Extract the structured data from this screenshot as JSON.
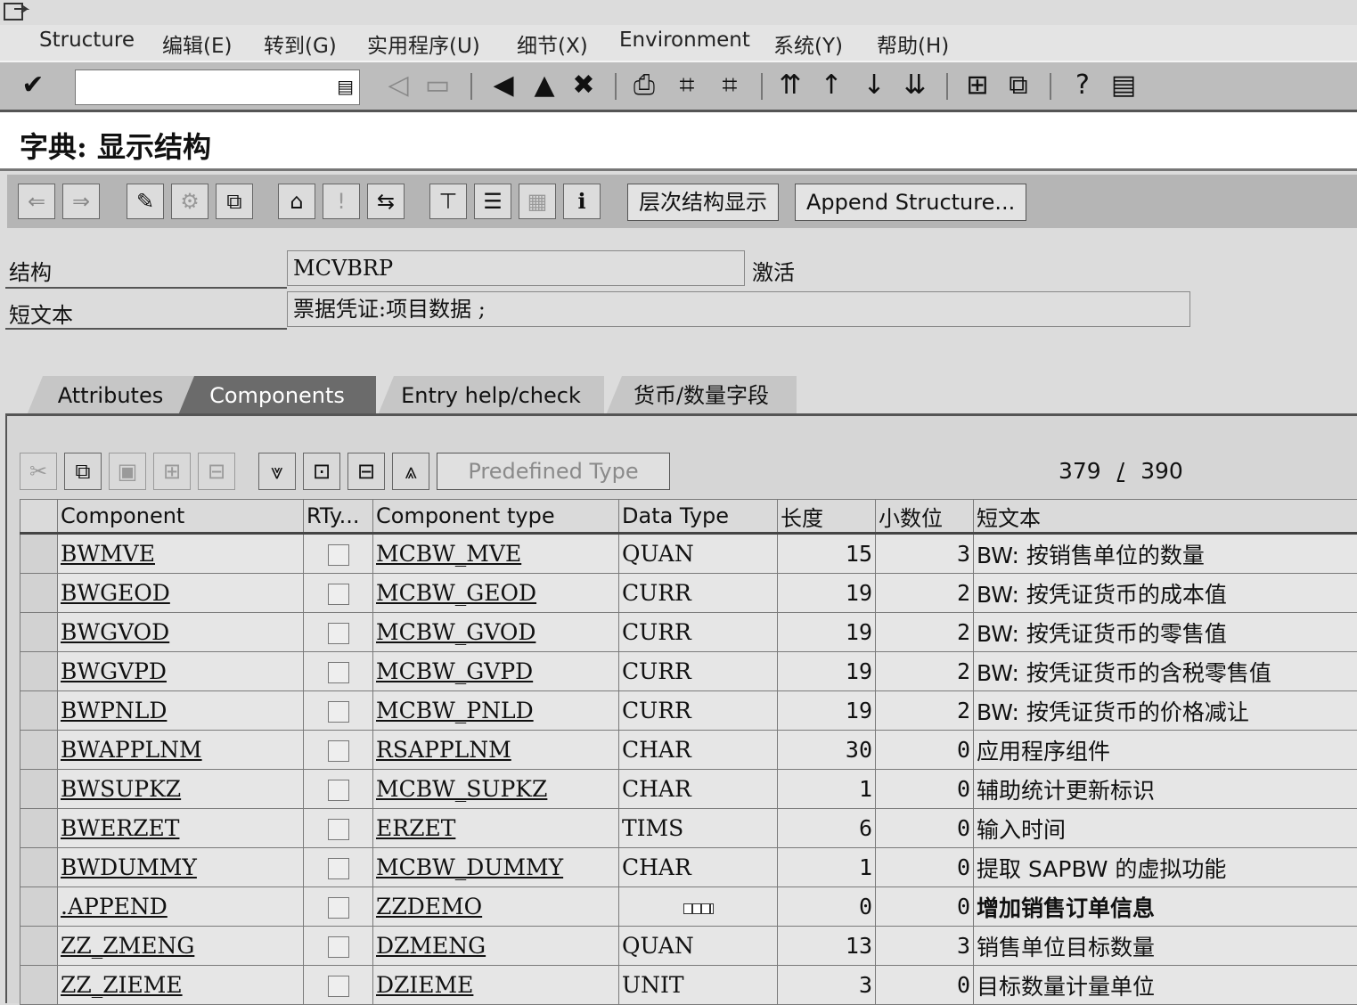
{
  "menu": [
    "Structure",
    "编辑(E)",
    "转到(G)",
    "实用程序(U)",
    "细节(X)",
    "Environment",
    "系统(Y)",
    "帮助(H)"
  ],
  "command_field": {
    "value": ""
  },
  "title": "字典: 显示结构",
  "app_toolbar": {
    "hierarchy_label": "层次结构显示",
    "append_label": "Append Structure..."
  },
  "form": {
    "structure_label": "结构",
    "structure_value": "MCVBRP",
    "status": "激活",
    "short_text_label": "短文本",
    "short_text_value": "票据凭证:项目数据   ;"
  },
  "tabs": [
    "Attributes",
    "Components",
    "Entry help/check",
    "货币/数量字段"
  ],
  "active_tab": "Components",
  "grid_toolbar": {
    "predefined_type_label": "Predefined Type"
  },
  "pager": {
    "current": "379",
    "sep": "/",
    "total": "390"
  },
  "columns": [
    "Component",
    "RTy...",
    "Component type",
    "Data Type",
    "长度",
    "小数位",
    "短文本"
  ],
  "rows": [
    {
      "component": "BWMVE",
      "ctype": "MCBW_MVE",
      "dtype": "QUAN",
      "len": "15",
      "dec": "3",
      "desc": "BW: 按销售单位的数量"
    },
    {
      "component": "BWGEOD",
      "ctype": "MCBW_GEOD",
      "dtype": "CURR",
      "len": "19",
      "dec": "2",
      "desc": "BW: 按凭证货币的成本值"
    },
    {
      "component": "BWGVOD",
      "ctype": "MCBW_GVOD",
      "dtype": "CURR",
      "len": "19",
      "dec": "2",
      "desc": "BW: 按凭证货币的零售值"
    },
    {
      "component": "BWGVPD",
      "ctype": "MCBW_GVPD",
      "dtype": "CURR",
      "len": "19",
      "dec": "2",
      "desc": "BW: 按凭证货币的含税零售值"
    },
    {
      "component": "BWPNLD",
      "ctype": "MCBW_PNLD",
      "dtype": "CURR",
      "len": "19",
      "dec": "2",
      "desc": "BW: 按凭证货币的价格减让"
    },
    {
      "component": "BWAPPLNM",
      "ctype": "RSAPPLNM",
      "dtype": "CHAR",
      "len": "30",
      "dec": "0",
      "desc": "应用程序组件"
    },
    {
      "component": "BWSUPKZ",
      "ctype": "MCBW_SUPKZ",
      "dtype": "CHAR",
      "len": "1",
      "dec": "0",
      "desc": "辅助统计更新标识"
    },
    {
      "component": "BWERZET",
      "ctype": "ERZET",
      "dtype": "TIMS",
      "len": "6",
      "dec": "0",
      "desc": "输入时间"
    },
    {
      "component": "BWDUMMY",
      "ctype": "MCBW_DUMMY",
      "dtype": "CHAR",
      "len": "1",
      "dec": "0",
      "desc": "提取 SAPBW 的虚拟功能"
    },
    {
      "component": ".APPEND",
      "ctype": "ZZDEMO",
      "dtype": "",
      "len": "0",
      "dec": "0",
      "desc": "增加销售订单信息"
    },
    {
      "component": "ZZ_ZMENG",
      "ctype": "DZMENG",
      "dtype": "QUAN",
      "len": "13",
      "dec": "3",
      "desc": "销售单位目标数量"
    },
    {
      "component": "ZZ_ZIEME",
      "ctype": "DZIEME",
      "dtype": "UNIT",
      "len": "3",
      "dec": "0",
      "desc": "目标数量计量单位"
    }
  ]
}
